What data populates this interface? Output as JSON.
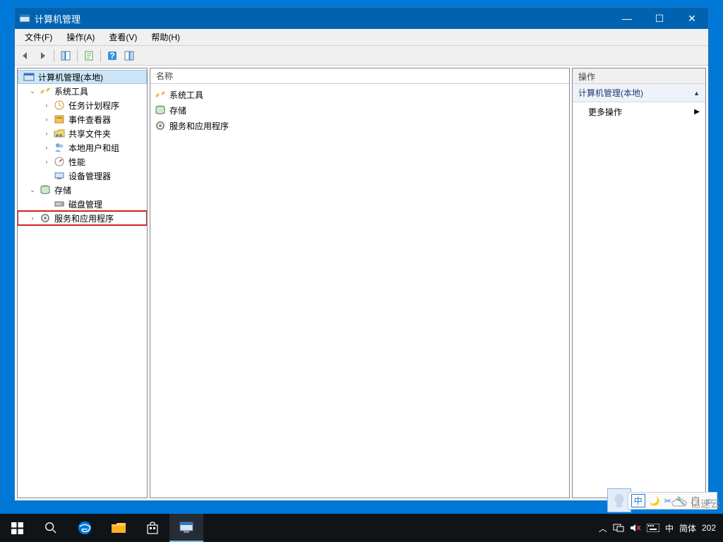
{
  "window": {
    "title": "计算机管理",
    "buttons": {
      "minimize": "—",
      "maximize": "☐",
      "close": "✕"
    }
  },
  "menu": {
    "file": "文件(F)",
    "action": "操作(A)",
    "view": "查看(V)",
    "help": "帮助(H)"
  },
  "tree": {
    "root": "计算机管理(本地)",
    "system_tools": "系统工具",
    "task_scheduler": "任务计划程序",
    "event_viewer": "事件查看器",
    "shared_folders": "共享文件夹",
    "local_users": "本地用户和组",
    "performance": "性能",
    "device_manager": "设备管理器",
    "storage": "存储",
    "disk_management": "磁盘管理",
    "services_apps": "服务和应用程序"
  },
  "list": {
    "header": "名称",
    "items": {
      "system_tools": "系统工具",
      "storage": "存储",
      "services_apps": "服务和应用程序"
    }
  },
  "actions": {
    "header": "操作",
    "group": "计算机管理(本地)",
    "more": "更多操作"
  },
  "taskbar": {
    "ime_lang": "中",
    "ime_mode": "简体",
    "clock_partial": "202"
  },
  "ime_float": {
    "mode": "中"
  },
  "watermark": "亿速云"
}
